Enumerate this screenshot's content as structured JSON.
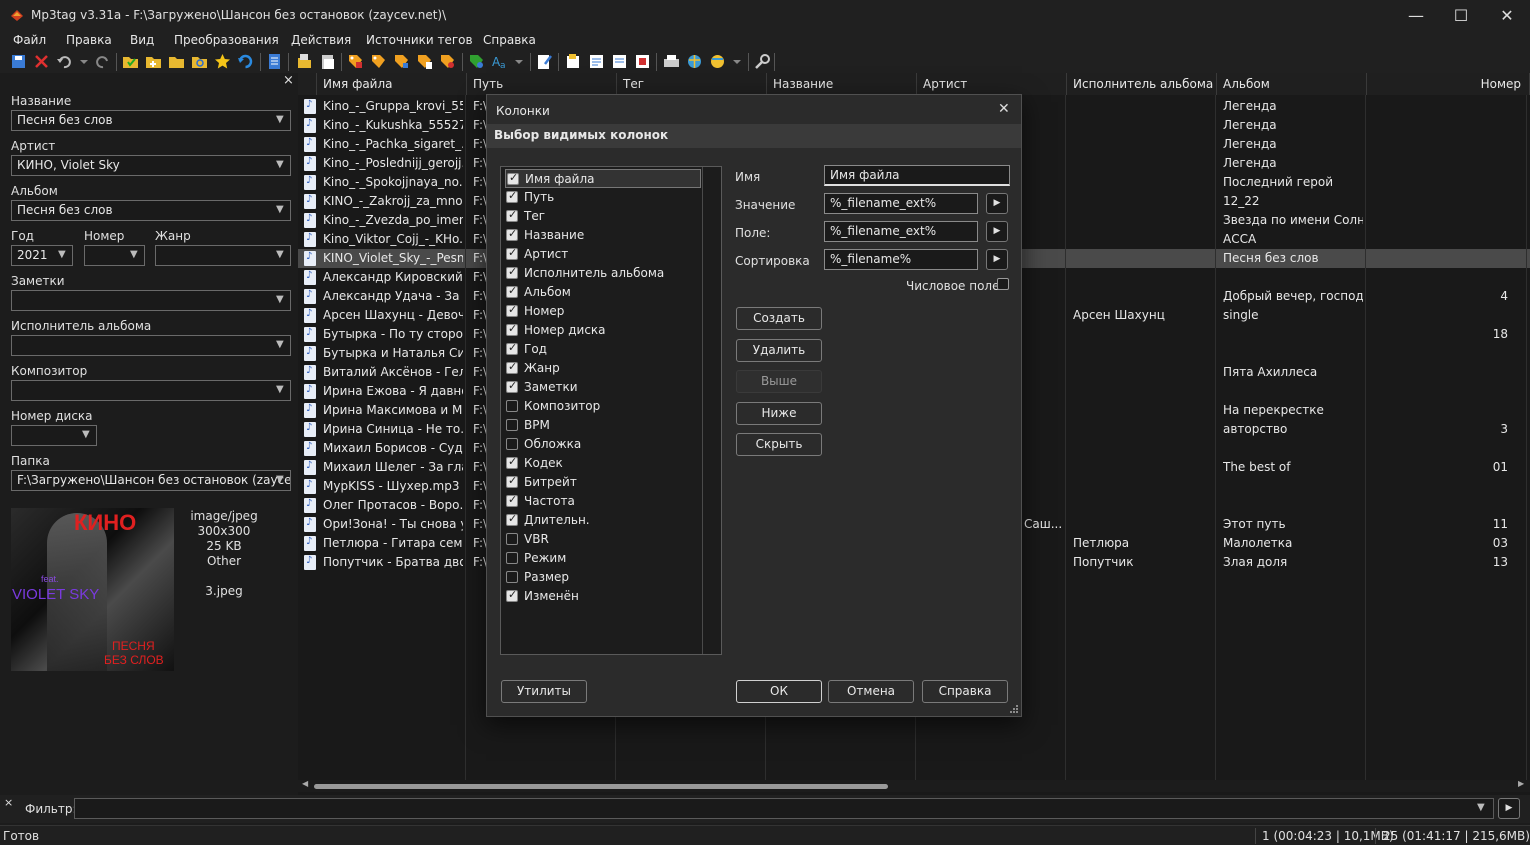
{
  "window": {
    "title": "Mp3tag v3.31a  -  F:\\Загружено\\Шансон без остановок (zaycev.net)\\",
    "min": "—",
    "max": "☐",
    "close": "✕"
  },
  "menu": [
    "Файл",
    "Правка",
    "Вид",
    "Преобразования",
    "Действия",
    "Источники тегов",
    "Справка"
  ],
  "left": {
    "close": "×",
    "title_label": "Название",
    "title_value": "Песня без слов",
    "artist_label": "Артист",
    "artist_value": "КИНО, Violet Sky",
    "album_label": "Альбом",
    "album_value": "Песня без слов",
    "year_label": "Год",
    "year_value": "2021",
    "track_label": "Номер",
    "track_value": "",
    "genre_label": "Жанр",
    "genre_value": "",
    "comment_label": "Заметки",
    "comment_value": "",
    "albumartist_label": "Исполнитель альбома",
    "albumartist_value": "",
    "composer_label": "Композитор",
    "composer_value": "",
    "disc_label": "Номер диска",
    "disc_value": "",
    "folder_label": "Папка",
    "folder_value": "F:\\Загружено\\Шансон без остановок (zaycev.n",
    "art_info": [
      "image/jpeg",
      "300x300",
      "25 KB",
      "Other",
      "",
      "3.jpeg"
    ],
    "art_text": [
      "КИНО",
      "feat.",
      "VIOLET SKY",
      "ПЕСНЯ",
      "БЕЗ СЛОВ"
    ]
  },
  "columns": [
    "Имя файла",
    "Путь",
    "Тег",
    "Название",
    "Артист",
    "Исполнитель альбома",
    "Альбом",
    "Номер"
  ],
  "rows": [
    {
      "file": "Kino_-_Gruppa_krovi_55...",
      "path": "F:\\",
      "albumartist": "",
      "album": "Легенда",
      "track": ""
    },
    {
      "file": "Kino_-_Kukushka_55527...",
      "path": "F:\\",
      "albumartist": "",
      "album": "Легенда",
      "track": ""
    },
    {
      "file": "Kino_-_Pachka_sigaret_...",
      "path": "F:\\",
      "albumartist": "",
      "album": "Легенда",
      "track": ""
    },
    {
      "file": "Kino_-_Poslednijj_gerojj...",
      "path": "F:\\",
      "albumartist": "",
      "album": "Легенда",
      "track": ""
    },
    {
      "file": "Kino_-_Spokojjnaya_no...",
      "path": "F:\\",
      "albumartist": "",
      "album": "Последний герой",
      "track": ""
    },
    {
      "file": "KINO_-_Zakrojj_za_mno...",
      "path": "F:\\",
      "albumartist": "",
      "album": "12_22",
      "track": ""
    },
    {
      "file": "Kino_-_Zvezda_po_imen...",
      "path": "F:\\",
      "albumartist": "",
      "album": "Звезда по имени Солн...",
      "track": ""
    },
    {
      "file": "Kino_Viktor_Cojj_-_KHo...",
      "path": "F:\\",
      "albumartist": "",
      "album": "АССА",
      "track": ""
    },
    {
      "file": "KINO_Violet_Sky_-_Pesn...",
      "path": "F:\\",
      "albumartist": "",
      "album": "Песня без слов",
      "track": "",
      "selected": true
    },
    {
      "file": "Александр Кировский ...",
      "path": "F:\\",
      "albumartist": "",
      "album": "",
      "track": ""
    },
    {
      "file": "Александр Удача - За д...",
      "path": "F:\\",
      "albumartist": "",
      "album": "Добрый вечер, господа",
      "track": "4"
    },
    {
      "file": "Арсен Шахунц - Девоч...",
      "path": "F:\\",
      "albumartist": "Арсен Шахунц",
      "album": "single",
      "track": ""
    },
    {
      "file": "Бутырка - По ту сторо...",
      "path": "F:\\",
      "albumartist": "",
      "album": "",
      "track": "18"
    },
    {
      "file": "Бутырка и Наталья Сиг...",
      "path": "F:\\",
      "albumartist": "",
      "album": "",
      "track": ""
    },
    {
      "file": "Виталий Аксёнов - Гел...",
      "path": "F:\\",
      "albumartist": "",
      "album": "Пята Ахиллеса",
      "track": ""
    },
    {
      "file": "Ирина Ежова - Я давно...",
      "path": "F:\\",
      "albumartist": "",
      "album": "",
      "track": ""
    },
    {
      "file": "Ирина Максимова и М...",
      "path": "F:\\",
      "albumartist": "",
      "album": "На перекрестке",
      "track": ""
    },
    {
      "file": "Ирина Синица - Не то...",
      "path": "F:\\",
      "albumartist": "",
      "album": "авторство",
      "track": "3"
    },
    {
      "file": "Михаил Борисов - Суд...",
      "path": "F:\\",
      "albumartist": "",
      "album": "",
      "track": ""
    },
    {
      "file": "Михаил Шелег - За гла...",
      "path": "F:\\",
      "albumartist": "",
      "album": "The best of",
      "track": "01"
    },
    {
      "file": "МурKISS - Шухер.mp3",
      "path": "F:\\",
      "albumartist": "",
      "album": "",
      "track": ""
    },
    {
      "file": "Олег Протасов - Воро...",
      "path": "F:\\",
      "albumartist": "",
      "album": "",
      "track": ""
    },
    {
      "file": "Ори!Зона! - Ты снова у...",
      "path": "F:\\",
      "artist": "Саш...",
      "albumartist": "",
      "album": "Этот путь",
      "track": "11"
    },
    {
      "file": "Петлюра - Гитара сем...",
      "path": "F:\\",
      "albumartist": "Петлюра",
      "album": "Малолетка",
      "track": "03"
    },
    {
      "file": "Попутчик - Братва дво...",
      "path": "F:\\",
      "albumartist": "Попутчик",
      "album": "Злая доля",
      "track": "13"
    }
  ],
  "filter": {
    "close": "×",
    "label": "Фильтр:",
    "value": ""
  },
  "status": {
    "left": "Готов",
    "sel": "1 (00:04:23 | 10,1MB)",
    "total": "25 (01:41:17 | 215,6MB)"
  },
  "dialog": {
    "title": "Колонки",
    "close": "✕",
    "section": "Выбор видимых колонок",
    "items": [
      {
        "label": "Имя файла",
        "checked": true
      },
      {
        "label": "Путь",
        "checked": true
      },
      {
        "label": "Тег",
        "checked": true
      },
      {
        "label": "Название",
        "checked": true
      },
      {
        "label": "Артист",
        "checked": true
      },
      {
        "label": "Исполнитель альбома",
        "checked": true
      },
      {
        "label": "Альбом",
        "checked": true
      },
      {
        "label": "Номер",
        "checked": true
      },
      {
        "label": "Номер диска",
        "checked": true
      },
      {
        "label": "Год",
        "checked": true
      },
      {
        "label": "Жанр",
        "checked": true
      },
      {
        "label": "Заметки",
        "checked": true
      },
      {
        "label": "Композитор",
        "checked": false
      },
      {
        "label": "BPM",
        "checked": false
      },
      {
        "label": "Обложка",
        "checked": false
      },
      {
        "label": "Кодек",
        "checked": true
      },
      {
        "label": "Битрейт",
        "checked": true
      },
      {
        "label": "Частота",
        "checked": true
      },
      {
        "label": "Длительн.",
        "checked": true
      },
      {
        "label": "VBR",
        "checked": false
      },
      {
        "label": "Режим",
        "checked": false
      },
      {
        "label": "Размер",
        "checked": false
      },
      {
        "label": "Изменён",
        "checked": true
      }
    ],
    "name_label": "Имя",
    "name_value": "Имя файла",
    "value_label": "Значение",
    "value_value": "%_filename_ext%",
    "field_label": "Поле:",
    "field_value": "%_filename_ext%",
    "sort_label": "Сортировка",
    "sort_value": "%_filename%",
    "numeric_label": "Числовое поле",
    "btn_create": "Создать",
    "btn_delete": "Удалить",
    "btn_up": "Выше",
    "btn_down": "Ниже",
    "btn_hide": "Скрыть",
    "btn_utils": "Утилиты",
    "btn_ok": "ОК",
    "btn_cancel": "Отмена",
    "btn_help": "Справка"
  }
}
